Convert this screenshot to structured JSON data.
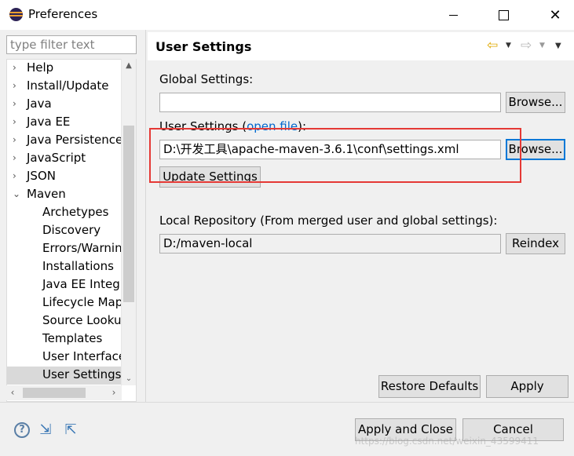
{
  "window": {
    "title": "Preferences",
    "minimize_glyph": "",
    "maximize_glyph": "",
    "close_glyph": "✕"
  },
  "filter": {
    "placeholder": "type filter text",
    "value": ""
  },
  "tree": {
    "items": [
      {
        "label": "Help",
        "arrow": "›",
        "expanded": false,
        "level": 0
      },
      {
        "label": "Install/Update",
        "arrow": "›",
        "expanded": false,
        "level": 0
      },
      {
        "label": "Java",
        "arrow": "›",
        "expanded": false,
        "level": 0
      },
      {
        "label": "Java EE",
        "arrow": "›",
        "expanded": false,
        "level": 0
      },
      {
        "label": "Java Persistence",
        "arrow": "›",
        "expanded": false,
        "level": 0
      },
      {
        "label": "JavaScript",
        "arrow": "›",
        "expanded": false,
        "level": 0
      },
      {
        "label": "JSON",
        "arrow": "›",
        "expanded": false,
        "level": 0
      },
      {
        "label": "Maven",
        "arrow": "⌄",
        "expanded": true,
        "level": 0
      },
      {
        "label": "Archetypes",
        "arrow": "",
        "level": 1
      },
      {
        "label": "Discovery",
        "arrow": "",
        "level": 1
      },
      {
        "label": "Errors/Warnin",
        "arrow": "",
        "level": 1
      },
      {
        "label": "Installations",
        "arrow": "",
        "level": 1
      },
      {
        "label": "Java EE Integra",
        "arrow": "",
        "level": 1
      },
      {
        "label": "Lifecycle Map",
        "arrow": "",
        "level": 1
      },
      {
        "label": "Source Looku",
        "arrow": "",
        "level": 1
      },
      {
        "label": "Templates",
        "arrow": "",
        "level": 1
      },
      {
        "label": "User Interface",
        "arrow": "",
        "level": 1
      },
      {
        "label": "User Settings",
        "arrow": "",
        "level": 1,
        "selected": true
      }
    ],
    "scroll_up": "▲",
    "scroll_down": "⌄",
    "scroll_left": "‹",
    "scroll_right": "›"
  },
  "page": {
    "title": "User Settings",
    "nav_back": "⇦",
    "nav_fwd": "⇨",
    "dropdown": "▼"
  },
  "global_settings": {
    "label": "Global Settings:",
    "value": "",
    "browse_label": "Browse..."
  },
  "user_settings": {
    "label_prefix": "User Settings (",
    "link": "open file",
    "label_suffix": "):",
    "value": "D:\\开发工具\\apache-maven-3.6.1\\conf\\settings.xml",
    "browse_label": "Browse...",
    "update_label": "Update Settings"
  },
  "local_repository": {
    "label": "Local Repository (From merged user and global settings):",
    "value": "D:/maven-local",
    "reindex_label": "Reindex"
  },
  "buttons": {
    "restore_defaults": "Restore Defaults",
    "apply": "Apply",
    "apply_and_close": "Apply and Close",
    "cancel": "Cancel"
  },
  "bottom_icons": {
    "help": "?",
    "import": "⇲",
    "export": "⇱"
  },
  "watermark": "https://blog.csdn.net/weixin_43599411",
  "colors": {
    "highlight_box": "#e53935",
    "link": "#0066cc",
    "selection": "#d9d9d9"
  }
}
